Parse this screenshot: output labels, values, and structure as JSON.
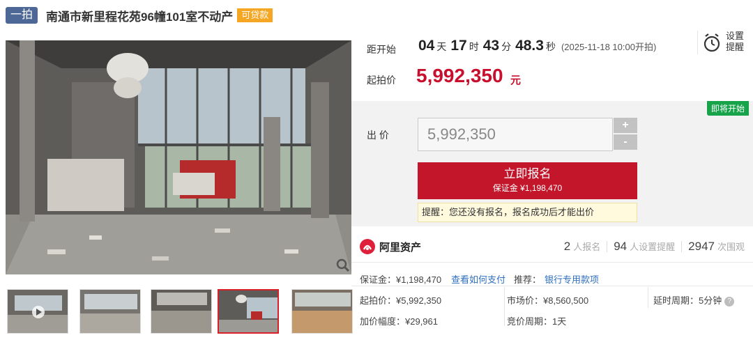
{
  "header": {
    "tag": "一拍",
    "title": "南通市新里程花苑96幢101室不动产",
    "loan_badge": "可贷款"
  },
  "gallery": {
    "main_image": "lobby-interior-photo",
    "selected_thumb": 3,
    "thumbs": [
      "thumb-1",
      "thumb-2",
      "thumb-3",
      "thumb-4",
      "thumb-5"
    ]
  },
  "countdown": {
    "label": "距开始",
    "days": "04",
    "days_unit": "天",
    "hours": "17",
    "hours_unit": "时",
    "minutes": "43",
    "minutes_unit": "分",
    "seconds": "48.3",
    "seconds_unit": "秒",
    "start_time": "(2025-11-18 10:00开拍)"
  },
  "reminder": {
    "label": "设置提醒",
    "icon": "alarm-clock-icon"
  },
  "starting_price": {
    "label": "起拍价",
    "value": "5,992,350",
    "unit": "元"
  },
  "bid": {
    "status_badge": "即将开始",
    "label": "出 价",
    "input_value": "5,992,350",
    "plus": "+",
    "minus": "-",
    "register_label": "立即报名",
    "deposit_line": "保证金 ¥1,198,470",
    "warning": "提醒：您还没有报名，报名成功后才能出价"
  },
  "platform": {
    "name": "阿里资产"
  },
  "stats": [
    {
      "value": "2",
      "label": "人报名"
    },
    {
      "value": "94",
      "label": "人设置提醒"
    },
    {
      "value": "2947",
      "label": "次围观"
    }
  ],
  "details": {
    "deposit": "保证金：¥1,198,470",
    "how_to_pay": "查看如何支付",
    "recommend_label": "推荐：",
    "recommend_link": "银行专用款项",
    "start_price": "起拍价：¥5,992,350",
    "market_price": "市场价：¥8,560,500",
    "delay_period": "延时周期：5分钟",
    "increment": "加价幅度：¥29,961",
    "bid_period": "竞价周期：1天"
  },
  "colors": {
    "accent": "#c3162b",
    "price": "#c8102e",
    "link": "#2f6fc0",
    "badge_green": "#17a34a",
    "tag_blue": "#4d6896",
    "loan_orange": "#f5a623"
  }
}
